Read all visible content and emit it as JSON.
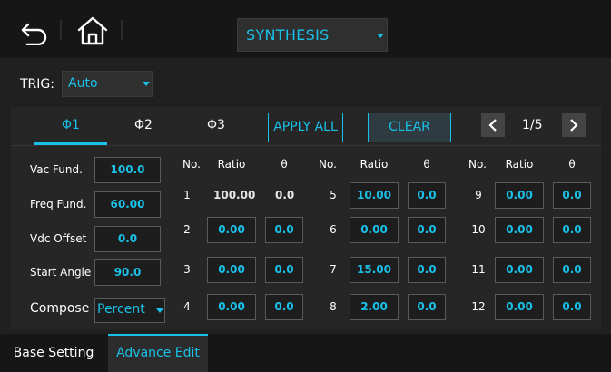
{
  "header": {
    "mode": "SYNTHESIS"
  },
  "trig": {
    "label": "TRIG:",
    "value": "Auto"
  },
  "tabs": [
    {
      "label": "Φ1"
    },
    {
      "label": "Φ2"
    },
    {
      "label": "Φ3"
    }
  ],
  "actions": {
    "apply_all": "APPLY ALL",
    "clear": "CLEAR"
  },
  "pager": {
    "page": "1/5"
  },
  "fundamental": {
    "vac_label": "Vac Fund.",
    "vac_value": "100.0",
    "freq_label": "Freq Fund.",
    "freq_value": "60.00",
    "vdc_label": "Vdc Offset",
    "vdc_value": "0.0",
    "angle_label": "Start Angle",
    "angle_value": "90.0",
    "compose_label": "Compose",
    "compose_value": "Percent"
  },
  "harmonics": {
    "headers": {
      "no": "No.",
      "ratio": "Ratio",
      "theta": "θ"
    },
    "rows": [
      {
        "no": "1",
        "ratio": "100.00",
        "theta": "0.0"
      },
      {
        "no": "2",
        "ratio": "0.00",
        "theta": "0.0"
      },
      {
        "no": "3",
        "ratio": "0.00",
        "theta": "0.0"
      },
      {
        "no": "4",
        "ratio": "0.00",
        "theta": "0.0"
      },
      {
        "no": "5",
        "ratio": "10.00",
        "theta": "0.0"
      },
      {
        "no": "6",
        "ratio": "0.00",
        "theta": "0.0"
      },
      {
        "no": "7",
        "ratio": "15.00",
        "theta": "0.0"
      },
      {
        "no": "8",
        "ratio": "2.00",
        "theta": "0.0"
      },
      {
        "no": "9",
        "ratio": "0.00",
        "theta": "0.0"
      },
      {
        "no": "10",
        "ratio": "0.00",
        "theta": "0.0"
      },
      {
        "no": "11",
        "ratio": "0.00",
        "theta": "0.0"
      },
      {
        "no": "12",
        "ratio": "0.00",
        "theta": "0.0"
      }
    ]
  },
  "bottom_tabs": {
    "base": "Base Setting",
    "advance": "Advance Edit"
  },
  "colors": {
    "accent": "#19c1e8",
    "background": "#202020",
    "panel": "#262626",
    "bar": "#161616"
  }
}
